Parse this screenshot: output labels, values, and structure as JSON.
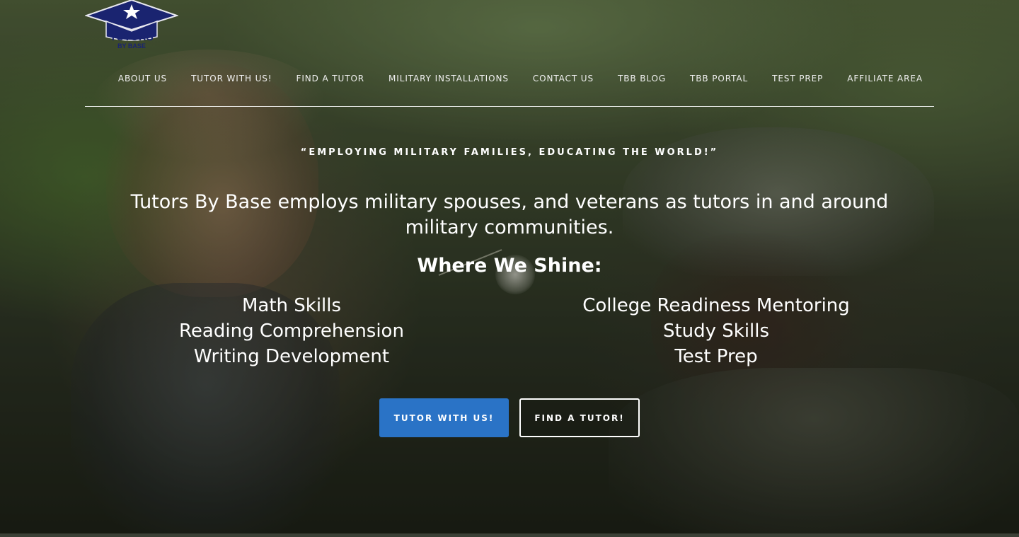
{
  "logo": {
    "text": "TUTORS",
    "subtext": "BY BASE"
  },
  "nav": {
    "items": [
      "ABOUT US",
      "TUTOR WITH US!",
      "FIND A TUTOR",
      "MILITARY INSTALLATIONS",
      "CONTACT US",
      "TBB BLOG",
      "TBB PORTAL",
      "TEST PREP",
      "AFFILIATE AREA"
    ]
  },
  "hero": {
    "tagline": "“EMPLOYING MILITARY FAMILIES, EDUCATING THE WORLD!”",
    "intro": "Tutors By Base employs military spouses, and veterans as tutors in and around military communities.",
    "shine_title": "Where We Shine:",
    "skills_left": [
      "Math Skills",
      "Reading Comprehension",
      "Writing Development"
    ],
    "skills_right": [
      "College Readiness Mentoring",
      "Study Skills",
      "Test Prep"
    ],
    "primary_button": "TUTOR WITH US!",
    "secondary_button": "FIND A TUTOR!"
  },
  "colors": {
    "primary_button": "#2a73c6",
    "logo_navy": "#1a2470"
  }
}
